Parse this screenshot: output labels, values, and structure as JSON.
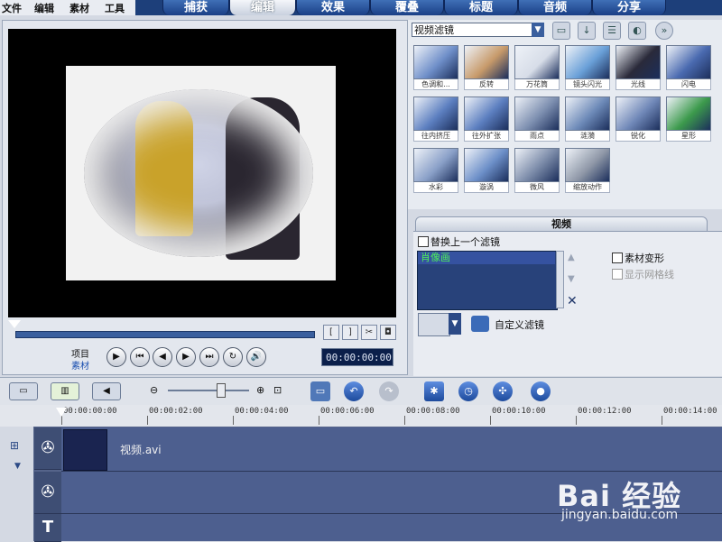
{
  "menu": [
    "文件",
    "编辑",
    "素材",
    "工具"
  ],
  "steps": [
    {
      "label": "捕获",
      "active": false
    },
    {
      "label": "编辑",
      "active": true
    },
    {
      "label": "效果",
      "active": false
    },
    {
      "label": "覆叠",
      "active": false
    },
    {
      "label": "标题",
      "active": false
    },
    {
      "label": "音频",
      "active": false
    },
    {
      "label": "分享",
      "active": false
    }
  ],
  "preview": {
    "mark_in": "[",
    "mark_out": "]",
    "project_label": "项目",
    "clip_label": "素材",
    "timecode": "00:00:00:00",
    "controls": [
      "play",
      "home",
      "prev-frame",
      "next-frame",
      "end",
      "repeat",
      "volume"
    ]
  },
  "library": {
    "selected": "视频滤镜",
    "filters": [
      "色调和...",
      "反转",
      "万花筒",
      "镜头闪光",
      "光线",
      "闪电",
      "往内挤压",
      "往外扩张",
      "雨点",
      "涟漪",
      "锐化",
      "星形",
      "水彩",
      "漩涡",
      "微风",
      "缩放动作"
    ]
  },
  "options": {
    "tab": "视频",
    "replace_last": "替换上一个滤镜",
    "applied": [
      "肖像画"
    ],
    "clip_deform": "素材变形",
    "show_grid": "显示网格线",
    "custom_filter": "自定义滤镜"
  },
  "timeline": {
    "ticks": [
      "00:00:00:00",
      "00:00:02:00",
      "00:00:04:00",
      "00:00:06:00",
      "00:00:08:00",
      "00:00:10:00",
      "00:00:12:00",
      "00:00:14:00"
    ],
    "clip_name": "视频.avi",
    "title_track_icon": "T"
  },
  "watermark": {
    "logo": "Bai  经验",
    "url": "jingyan.baidu.com"
  },
  "colors": {
    "tab_blue": "#1d3f7a",
    "applied_text": "#4ef05a",
    "track_bg": "#4d5f8f"
  }
}
